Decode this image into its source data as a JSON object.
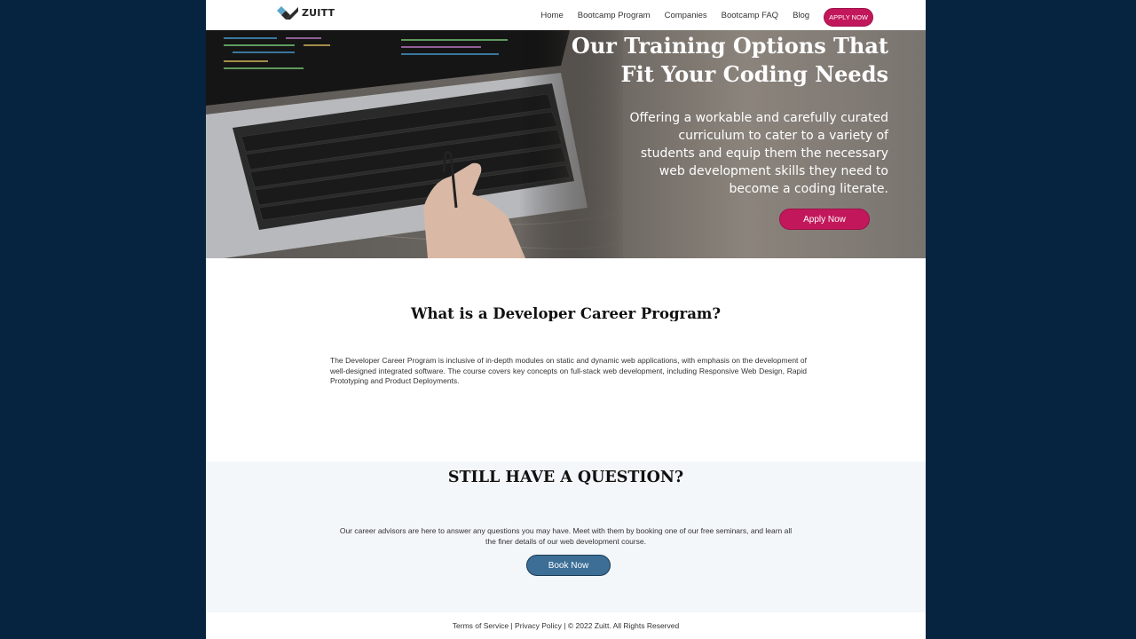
{
  "nav": {
    "logo_text": "ZUITT",
    "links": [
      "Home",
      "Bootcamp Program",
      "Companies",
      "Bootcamp FAQ",
      "Blog"
    ],
    "apply_label": "APPLY NOW"
  },
  "hero": {
    "title": "Our Training Options That Fit Your Coding Needs",
    "text": "Offering a workable and carefully curated curriculum to cater to a variety of students and equip them the necessary web development skills they need to become a coding literate.",
    "button_label": "Apply Now"
  },
  "about": {
    "title": "What is a Developer Career Program?",
    "text": "The Developer Career Program is inclusive of in-depth modules on static and dynamic web applications, with emphasis on the development of well-designed integrated software. The course covers key concepts on full-stack web development, including Responsive Web Design, Rapid Prototyping and Product Deployments."
  },
  "question": {
    "title": "STILL HAVE A QUESTION?",
    "text": "Our career advisors are here to answer any questions you may have. Meet with them by booking one of our free seminars, and learn all the finer details of our web development course.",
    "button_label": "Book Now"
  },
  "footer": {
    "terms": "Terms of Service",
    "privacy": "Privacy Policy",
    "copyright": "© 2022 Zuitt. All Rights Reserved"
  },
  "colors": {
    "accent": "#c2185b",
    "book_button": "#3c6e96",
    "background": "#062340"
  }
}
